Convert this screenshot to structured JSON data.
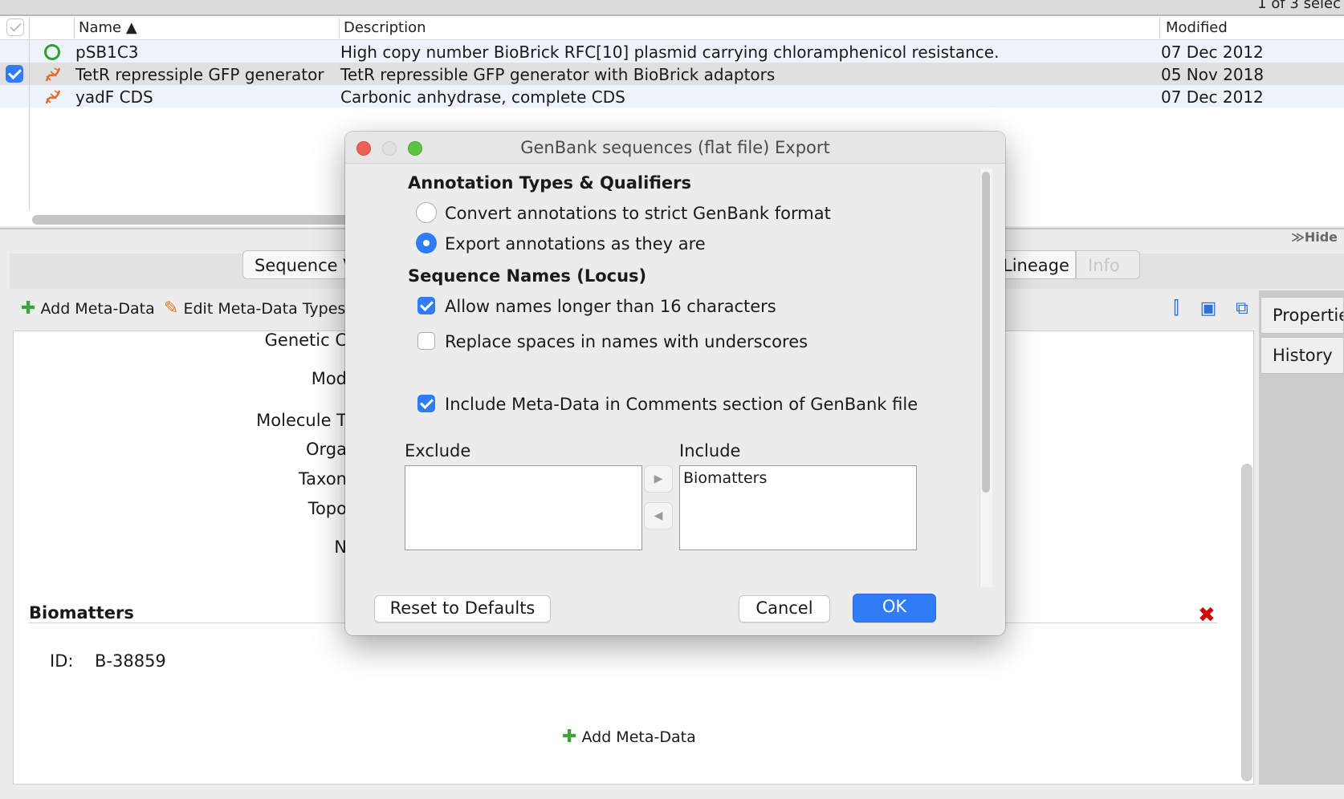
{
  "table": {
    "selection_count": "1 of 3 selec",
    "headers": {
      "name": "Name ▲",
      "description": "Description",
      "modified": "Modified"
    },
    "rows": [
      {
        "name": "pSB1C3",
        "description": "High copy number BioBrick RFC[10] plasmid carrying chloramphenicol resistance.",
        "modified": "07 Dec 2012",
        "icon": "circular-dna-icon",
        "checked": false
      },
      {
        "name": "TetR repressiple GFP generator",
        "description": "TetR repressible GFP generator with BioBrick adaptors",
        "modified": "05 Nov 2018",
        "icon": "linear-dna-icon",
        "checked": true
      },
      {
        "name": "yadF CDS",
        "description": "Carbonic anhydrase, complete CDS",
        "modified": "07 Dec 2012",
        "icon": "linear-dna-icon",
        "checked": false
      }
    ],
    "hide_label": "≫Hide"
  },
  "tabs": {
    "sequence": "Sequence V",
    "lineage": "Lineage",
    "info": "Info"
  },
  "toolbar": {
    "add_meta": "Add Meta-Data",
    "edit_meta_types": "Edit Meta-Data Types"
  },
  "fields": {
    "genetic_code": "Genetic C",
    "mod": "Mod",
    "molecule": "Molecule T",
    "organism": "Orga",
    "taxon": "Taxon",
    "topology": "Topo",
    "n": "N"
  },
  "biomatters": {
    "heading": "Biomatters",
    "id_label": "ID:",
    "id_value": "B-38859",
    "add_meta": "Add Meta-Data"
  },
  "side_tabs": {
    "properties": "Propertie",
    "history": "History"
  },
  "dialog": {
    "title": "GenBank sequences (flat file) Export",
    "annotation_heading": "Annotation Types & Qualifiers",
    "radio_convert": "Convert annotations to strict GenBank format",
    "radio_export": "Export annotations as they are",
    "names_heading": "Sequence Names (Locus)",
    "check_long_names": "Allow names longer than 16 characters",
    "check_replace_spaces": "Replace spaces in names with underscores",
    "check_include_meta": "Include Meta-Data in Comments section of GenBank file",
    "exclude_label": "Exclude",
    "include_label": "Include",
    "include_items": [
      "Biomatters"
    ],
    "reset_button": "Reset to Defaults",
    "cancel_button": "Cancel",
    "ok_button": "OK"
  },
  "colors": {
    "accent": "#2f7cf6",
    "delete": "#d4000a",
    "add": "#3aa63a"
  }
}
